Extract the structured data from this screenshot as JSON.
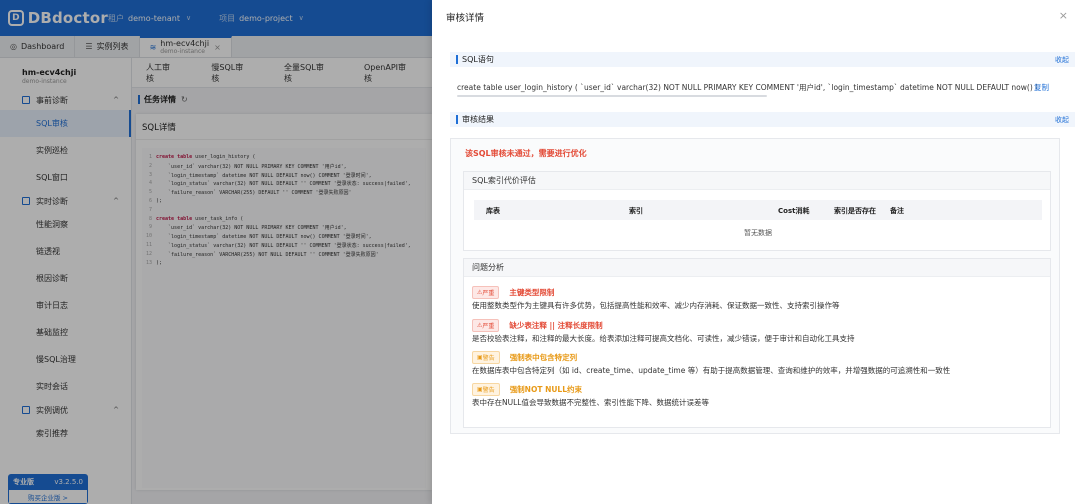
{
  "app": {
    "logo_mark": "D",
    "logo_text": "DBdoctor",
    "tenant_label": "租户",
    "tenant_value": "demo-tenant",
    "project_label": "项目",
    "project_value": "demo-project"
  },
  "tabs": [
    {
      "label": "Dashboard",
      "icon": "dashboard-icon"
    },
    {
      "label": "实例列表",
      "icon": "list-icon"
    },
    {
      "label": "hm-ecv4chji",
      "sub": "demo-instance",
      "icon": "database-icon"
    }
  ],
  "sidebar": {
    "instance_name": "hm-ecv4chji",
    "instance_sub": "demo-instance",
    "groups": [
      {
        "label": "事前诊断",
        "items": [
          "SQL审核",
          "实例巡检",
          "SQL窗口"
        ]
      },
      {
        "label": "实时诊断",
        "items": [
          "性能洞察",
          "链透视",
          "根因诊断",
          "审计日志",
          "基础监控",
          "慢SQL治理",
          "实时会话"
        ]
      },
      {
        "label": "实例调优",
        "items": [
          "索引推荐"
        ]
      }
    ],
    "edition": {
      "name": "专业版",
      "version": "v3.2.5.0",
      "upgrade": "购买企业版 >"
    }
  },
  "content": {
    "tabs": [
      "人工审核",
      "慢SQL审核",
      "全量SQL审核",
      "OpenAPI审核"
    ],
    "task_title": "任务详情",
    "panel_title": "SQL详情",
    "code_lines": [
      {
        "n": "1",
        "kw": "create table ",
        "t": "user_login_history ("
      },
      {
        "n": "2",
        "kw": "",
        "t": "    `user_id` varchar(32) NOT NULL PRIMARY KEY COMMENT '用户id',"
      },
      {
        "n": "3",
        "kw": "",
        "t": "    `login_timestamp` datetime NOT NULL DEFAULT now() COMMENT '登录时间',"
      },
      {
        "n": "4",
        "kw": "",
        "t": "    `login_status` varchar(32) NOT NULL DEFAULT '' COMMENT '登录状态: success|failed',"
      },
      {
        "n": "5",
        "kw": "",
        "t": "    `failure_reason` VARCHAR(255) DEFAULT '' COMMENT '登录失败原因'"
      },
      {
        "n": "6",
        "kw": "",
        "t": ");"
      },
      {
        "n": "7",
        "kw": "",
        "t": ""
      },
      {
        "n": "8",
        "kw": "create table ",
        "t": "user_task_info ("
      },
      {
        "n": "9",
        "kw": "",
        "t": "    `user_id` varchar(32) NOT NULL PRIMARY KEY COMMENT '用户id',"
      },
      {
        "n": "10",
        "kw": "",
        "t": "    `login_timestamp` datetime NOT NULL DEFAULT now() COMMENT '登录时间',"
      },
      {
        "n": "11",
        "kw": "",
        "t": "    `login_status` varchar(32) NOT NULL DEFAULT '' COMMENT '登录状态: success|failed',"
      },
      {
        "n": "12",
        "kw": "",
        "t": "    `failure_reason` VARCHAR(255) NOT NULL DEFAULT '' COMMENT '登录失败原因'"
      },
      {
        "n": "13",
        "kw": "",
        "t": ");"
      }
    ]
  },
  "drawer": {
    "title": "审核详情",
    "close": "×",
    "sql_section": "SQL语句",
    "collapse": "收起",
    "sql_text": "create table user_login_history ( `user_id` varchar(32) NOT NULL PRIMARY KEY COMMENT '用户id', `login_timestamp` datetime NOT NULL DEFAULT now() COMMENT",
    "copy": "复制",
    "result_section": "审核结果",
    "fail_msg": "该SQL审核未通过，需要进行优化",
    "eval_title": "SQL索引代价评估",
    "eval_columns": [
      "库表",
      "索引",
      "Cost消耗",
      "索引是否存在",
      "备注"
    ],
    "no_data": "暂无数据",
    "issue_title": "问题分析",
    "issues": [
      {
        "level": "严重",
        "kind": "sev",
        "title": "主键类型限制",
        "desc": "使用整数类型作为主键具有许多优势，包括提高性能和效率、减少内存消耗、保证数据一致性、支持索引操作等"
      },
      {
        "level": "严重",
        "kind": "sev",
        "title": "缺少表注释 || 注释长度限制",
        "desc": "是否校验表注释，和注释的最大长度。给表添加注释可提高文档化、可读性，减少错误，便于审计和自动化工具支持"
      },
      {
        "level": "警告",
        "kind": "warn",
        "title": "强制表中包含特定列",
        "desc": "在数据库表中包含特定列（如 id、create_time、update_time 等）有助于提高数据管理、查询和维护的效率，并增强数据的可追溯性和一致性"
      },
      {
        "level": "警告",
        "kind": "warn",
        "title": "强制NOT NULL约束",
        "desc": "表中存在NULL值会导致数据不完整性、索引性能下降、数据统计误差等"
      }
    ]
  }
}
